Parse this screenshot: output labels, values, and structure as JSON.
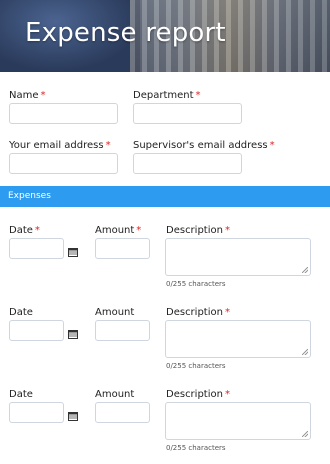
{
  "header": {
    "title": "Expense report"
  },
  "form": {
    "name_label": "Name",
    "department_label": "Department",
    "email_label": "Your email address",
    "supervisor_email_label": "Supervisor's email address",
    "required_mark": "*"
  },
  "expenses": {
    "section_title": "Expenses",
    "rows": [
      {
        "date_label": "Date",
        "date_required": true,
        "amount_label": "Amount",
        "amount_required": true,
        "description_label": "Description",
        "description_required": true,
        "char_count": "0/255 characters"
      },
      {
        "date_label": "Date",
        "date_required": false,
        "amount_label": "Amount",
        "amount_required": false,
        "description_label": "Description",
        "description_required": true,
        "char_count": "0/255 characters"
      },
      {
        "date_label": "Date",
        "date_required": false,
        "amount_label": "Amount",
        "amount_required": false,
        "description_label": "Description",
        "description_required": true,
        "char_count": "0/255 characters"
      }
    ]
  },
  "icons": {
    "date_picker": "calendar-icon"
  },
  "colors": {
    "accent": "#2d9cf0",
    "required": "#e02424",
    "border": "#cfd6df"
  }
}
